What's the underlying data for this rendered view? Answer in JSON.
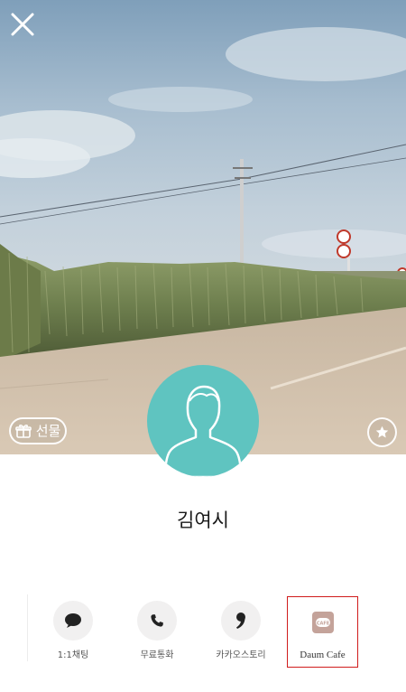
{
  "profile": {
    "name": "김여시"
  },
  "header": {
    "close_icon": "close-icon"
  },
  "cover": {
    "gift_label": "선물",
    "gift_icon": "gift-icon",
    "favorite_icon": "star-icon"
  },
  "actions": [
    {
      "label": "1:1채팅",
      "icon": "chat-bubble-icon"
    },
    {
      "label": "무료통화",
      "icon": "phone-icon"
    },
    {
      "label": "카카오스토리",
      "icon": "comma-icon"
    },
    {
      "label": "Daum Cafe",
      "icon": "cafe-icon"
    }
  ],
  "colors": {
    "avatar_bg": "#5fc4c0",
    "highlight_border": "#d01c1c",
    "action_circle": "#f1f0f0"
  }
}
